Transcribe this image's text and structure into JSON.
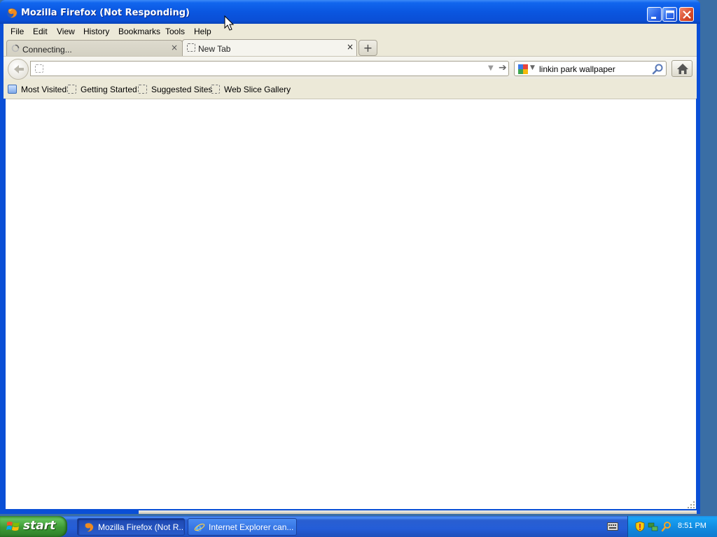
{
  "window": {
    "title": "Mozilla Firefox (Not Responding)"
  },
  "menubar": {
    "items": [
      {
        "label": "File"
      },
      {
        "label": "Edit"
      },
      {
        "label": "View"
      },
      {
        "label": "History"
      },
      {
        "label": "Bookmarks"
      },
      {
        "label": "Tools"
      },
      {
        "label": "Help"
      }
    ]
  },
  "tabs": [
    {
      "label": "Connecting...",
      "state": "loading",
      "active": false
    },
    {
      "label": "New Tab",
      "state": "idle",
      "active": true
    }
  ],
  "tab_close_glyph": "×",
  "new_tab_glyph": "+",
  "navbar": {
    "url_value": "",
    "search": {
      "engine_icon": "google-icon",
      "value": "linkin park wallpaper"
    }
  },
  "bookmarks": [
    {
      "label": "Most Visited",
      "icon": "most-visited-icon"
    },
    {
      "label": "Getting Started",
      "icon": "page-icon"
    },
    {
      "label": "Suggested Sites",
      "icon": "page-icon"
    },
    {
      "label": "Web Slice Gallery",
      "icon": "page-icon"
    }
  ],
  "taskbar": {
    "start_label": "start",
    "tasks": [
      {
        "label": "Mozilla Firefox (Not R...",
        "icon": "firefox-icon",
        "active": true
      },
      {
        "label": "Internet Explorer can...",
        "icon": "internet-explorer-icon",
        "active": false
      }
    ],
    "tray_icons": [
      "security-shield-icon",
      "network-icon",
      "search-icon"
    ],
    "clock": "8:51 PM"
  },
  "colors": {
    "xp_blue": "#0a4fd6",
    "start_green": "#3d9a35",
    "chrome_bg": "#ece9d8"
  }
}
